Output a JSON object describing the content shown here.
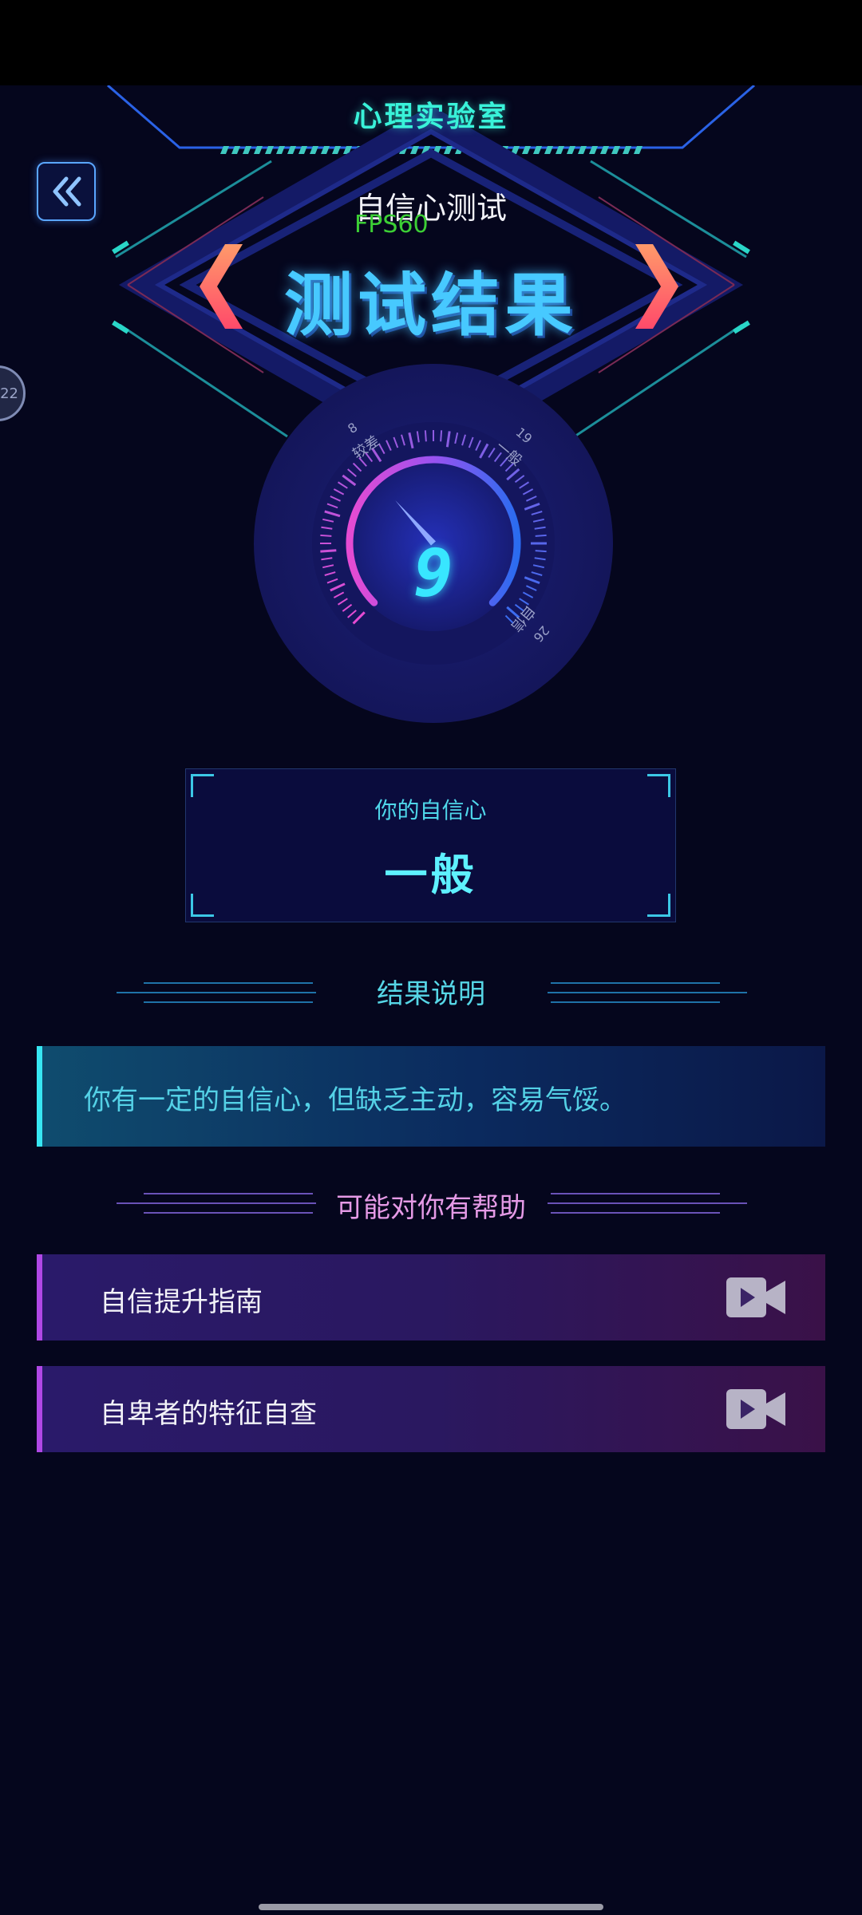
{
  "header": {
    "app_title": "心理实验室",
    "test_name": "自信心测试",
    "fps": "FPS60",
    "result_title": "测试结果",
    "side_badge": "22"
  },
  "gauge": {
    "value": "9",
    "min": 0,
    "max": 26,
    "segments": [
      {
        "label": "较差",
        "threshold": "8"
      },
      {
        "label": "一般",
        "threshold": "19"
      },
      {
        "label": "自信",
        "threshold": "26"
      }
    ]
  },
  "result": {
    "label": "你的自信心",
    "value": "一般"
  },
  "explanation": {
    "heading": "结果说明",
    "text": "你有一定的自信心，但缺乏主动，容易气馁。"
  },
  "help": {
    "heading": "可能对你有帮助",
    "items": [
      {
        "label": "自信提升指南",
        "icon": "video-camera-icon"
      },
      {
        "label": "自卑者的特征自查",
        "icon": "video-camera-icon"
      }
    ]
  },
  "colors": {
    "background": "#05061d",
    "accent_cyan": "#39f2d9",
    "accent_purple": "#b048e6",
    "gauge_pink": "#e64bd2",
    "gauge_blue": "#3a6cf0"
  }
}
